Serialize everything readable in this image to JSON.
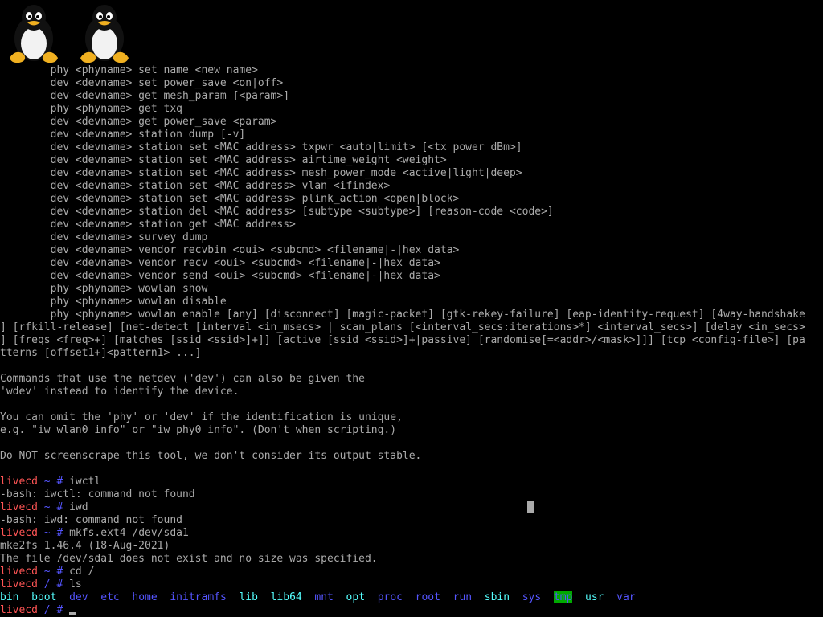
{
  "help_lines": [
    "        phy <phyname> set name <new name>",
    "        dev <devname> set power_save <on|off>",
    "        dev <devname> get mesh_param [<param>]",
    "        phy <phyname> get txq",
    "        dev <devname> get power_save <param>",
    "        dev <devname> station dump [-v]",
    "        dev <devname> station set <MAC address> txpwr <auto|limit> [<tx power dBm>]",
    "        dev <devname> station set <MAC address> airtime_weight <weight>",
    "        dev <devname> station set <MAC address> mesh_power_mode <active|light|deep>",
    "        dev <devname> station set <MAC address> vlan <ifindex>",
    "        dev <devname> station set <MAC address> plink_action <open|block>",
    "        dev <devname> station del <MAC address> [subtype <subtype>] [reason-code <code>]",
    "        dev <devname> station get <MAC address>",
    "        dev <devname> survey dump",
    "        dev <devname> vendor recvbin <oui> <subcmd> <filename|-|hex data>",
    "        dev <devname> vendor recv <oui> <subcmd> <filename|-|hex data>",
    "        dev <devname> vendor send <oui> <subcmd> <filename|-|hex data>",
    "        phy <phyname> wowlan show",
    "        phy <phyname> wowlan disable",
    "        phy <phyname> wowlan enable [any] [disconnect] [magic-packet] [gtk-rekey-failure] [eap-identity-request] [4way-handshake",
    "] [rfkill-release] [net-detect [interval <in_msecs> | scan_plans [<interval_secs:iterations>*] <interval_secs>] [delay <in_secs>",
    "] [freqs <freq>+] [matches [ssid <ssid>]+]] [active [ssid <ssid>]+|passive] [randomise[=<addr>/<mask>]]] [tcp <config-file>] [pa",
    "tterns [offset1+]<pattern1> ...]",
    "",
    "Commands that use the netdev ('dev') can also be given the",
    "'wdev' instead to identify the device.",
    "",
    "You can omit the 'phy' or 'dev' if the identification is unique,",
    "e.g. \"iw wlan0 info\" or \"iw phy0 info\". (Don't when scripting.)",
    "",
    "Do NOT screenscrape this tool, we don't consider its output stable.",
    ""
  ],
  "session": [
    {
      "host": "livecd",
      "path": " ~ # ",
      "cmd": "iwctl"
    },
    {
      "out": "-bash: iwctl: command not found"
    },
    {
      "host": "livecd",
      "path": " ~ # ",
      "cmd": "iwd"
    },
    {
      "out": "-bash: iwd: command not found"
    },
    {
      "host": "livecd",
      "path": " ~ # ",
      "cmd": "mkfs.ext4 /dev/sda1"
    },
    {
      "out": "mke2fs 1.46.4 (18-Aug-2021)"
    },
    {
      "out": "The file /dev/sda1 does not exist and no size was specified."
    },
    {
      "host": "livecd",
      "path": " ~ # ",
      "cmd": "cd /"
    },
    {
      "host": "livecd",
      "path": " / # ",
      "cmd": "ls"
    }
  ],
  "ls_entries": [
    {
      "name": "bin",
      "kind": "exec"
    },
    {
      "name": "boot",
      "kind": "exec"
    },
    {
      "name": "dev",
      "kind": "dir"
    },
    {
      "name": "etc",
      "kind": "dir"
    },
    {
      "name": "home",
      "kind": "dir"
    },
    {
      "name": "initramfs",
      "kind": "dir"
    },
    {
      "name": "lib",
      "kind": "exec"
    },
    {
      "name": "lib64",
      "kind": "exec"
    },
    {
      "name": "mnt",
      "kind": "dir"
    },
    {
      "name": "opt",
      "kind": "exec"
    },
    {
      "name": "proc",
      "kind": "dir"
    },
    {
      "name": "root",
      "kind": "dir"
    },
    {
      "name": "run",
      "kind": "dir"
    },
    {
      "name": "sbin",
      "kind": "exec"
    },
    {
      "name": "sys",
      "kind": "dir"
    },
    {
      "name": "tmp",
      "kind": "tmp"
    },
    {
      "name": "usr",
      "kind": "exec"
    },
    {
      "name": "var",
      "kind": "dir"
    }
  ],
  "final_prompt": {
    "host": "livecd",
    "path": " / # "
  },
  "logos": [
    {
      "icon": "tux-penguin-icon"
    },
    {
      "icon": "tux-penguin-icon"
    }
  ],
  "colors": {
    "background": "#000000",
    "text": "#ababab",
    "prompt_host": "#ff5555",
    "prompt_path": "#5555ff",
    "ls_dir": "#5555ff",
    "ls_exec": "#55ffff",
    "ls_tmp_bg": "#00aa00"
  }
}
